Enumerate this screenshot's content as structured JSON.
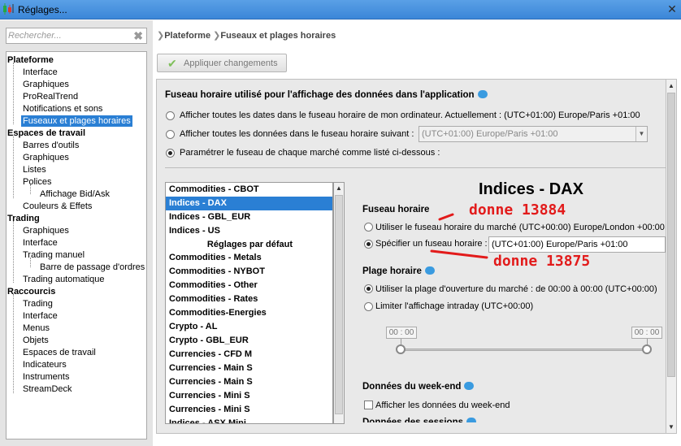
{
  "window": {
    "title": "Réglages...",
    "close_glyph": "✕",
    "icon": "chart-candles-icon"
  },
  "search": {
    "placeholder": "Rechercher...",
    "clear_glyph": "✖"
  },
  "tree": {
    "plateforme": {
      "label": "Plateforme",
      "items": [
        "Interface",
        "Graphiques",
        "ProRealTrend",
        "Notifications et sons",
        "Fuseaux et plages horaires"
      ]
    },
    "espaces": {
      "label": "Espaces de travail",
      "items": [
        "Barres d'outils",
        "Graphiques",
        "Listes",
        "Polices",
        "Affichage Bid/Ask",
        "Couleurs & Effets"
      ]
    },
    "trading": {
      "label": "Trading",
      "items": [
        "Graphiques",
        "Interface",
        "Trading manuel",
        "Barre de passage d'ordres",
        "Trading automatique"
      ]
    },
    "raccourcis": {
      "label": "Raccourcis",
      "items": [
        "Trading",
        "Interface",
        "Menus",
        "Objets",
        "Espaces de travail",
        "Indicateurs",
        "Instruments",
        "StreamDeck"
      ]
    }
  },
  "breadcrumb": {
    "level1": "Plateforme",
    "level2": "Fuseaux et plages horaires"
  },
  "apply_button": {
    "label": "Appliquer changements"
  },
  "timezone": {
    "heading": "Fuseau horaire utilisé pour l'affichage des données dans l'application",
    "opt1": "Afficher toutes les dates dans le fuseau horaire de mon ordinateur. Actuellement : (UTC+01:00) Europe/Paris +01:00",
    "opt2": "Afficher toutes les données dans le fuseau horaire suivant :",
    "opt2_combo": "(UTC+01:00) Europe/Paris +01:00",
    "opt3": "Paramétrer le fuseau de chaque marché comme listé ci-dessous :",
    "selected": 3
  },
  "markets": {
    "items": [
      "Commodities - CBOT",
      "Indices - DAX",
      "Indices - GBL_EUR",
      "Indices - US",
      "Réglages par défaut",
      "Commodities - Metals",
      "Commodities - NYBOT",
      "Commodities - Other",
      "Commodities - Rates",
      "Commodities-Energies",
      "Crypto - AL",
      "Crypto - GBL_EUR",
      "Currencies - CFD M",
      "Currencies - Main S",
      "Currencies - Main S",
      "Currencies - Mini S",
      "Currencies - Mini S",
      "Indices - ASX Mini"
    ],
    "selected_index": 1
  },
  "detail": {
    "title": "Indices - DAX",
    "fuseau": {
      "heading": "Fuseau horaire",
      "opt1": "Utiliser le fuseau horaire du marché (UTC+00:00) Europe/London +00:00",
      "opt2": "Spécifier un fuseau horaire :",
      "opt2_value": "(UTC+01:00) Europe/Paris +01:00",
      "selected": 2
    },
    "plage": {
      "heading": "Plage horaire",
      "opt1": "Utiliser la plage d'ouverture du marché : de 00:00 à 00:00  (UTC+00:00)",
      "opt2": "Limiter l'affichage intraday  (UTC+00:00)",
      "selected": 1,
      "start": "00 : 00",
      "end": "00 : 00"
    },
    "weekend": {
      "heading": "Données du week-end",
      "checkbox": "Afficher les données du week-end",
      "checked": false
    },
    "next_heading_partial": "Données des sessions"
  },
  "annotations": {
    "a1": "donne 13884",
    "a2": "donne 13875",
    "color": "#e21b1b"
  },
  "colors": {
    "selection": "#2a7fd4",
    "titlebar": "#3b86d8",
    "info": "#3a9be0"
  }
}
